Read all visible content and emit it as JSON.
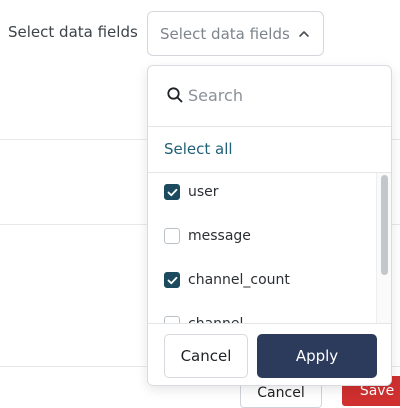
{
  "field": {
    "label": "Select data fields",
    "trigger_text": "Select data fields"
  },
  "dropdown": {
    "search_placeholder": "Search",
    "select_all": "Select all",
    "options": [
      {
        "label": "user",
        "checked": true
      },
      {
        "label": "message",
        "checked": false
      },
      {
        "label": "channel_count",
        "checked": true
      },
      {
        "label": "channel",
        "checked": false
      }
    ],
    "cancel_label": "Cancel",
    "apply_label": "Apply"
  },
  "background": {
    "cancel_label": "Cancel",
    "primary_label": "Save"
  },
  "colors": {
    "accent": "#1c4a5e",
    "apply_button": "#2c3a5c",
    "link": "#1f5f78",
    "danger": "#d0302f"
  },
  "icons": {
    "trigger": "chevron-up-icon",
    "search": "search-icon",
    "check": "check-icon"
  }
}
